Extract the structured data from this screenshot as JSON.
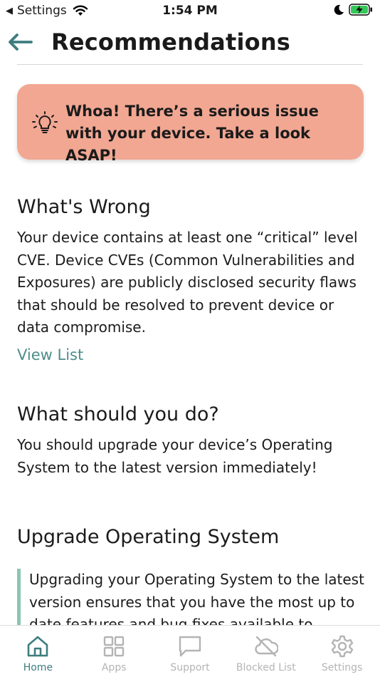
{
  "status_bar": {
    "back_app": "Settings",
    "time": "1:54 PM"
  },
  "header": {
    "title": "Recommendations"
  },
  "alert": {
    "text": "Whoa! There’s a serious issue with your device. Take a look ASAP!",
    "color": "#f2a792"
  },
  "sections": {
    "wrong": {
      "heading": "What's Wrong",
      "body": "Your device contains at least one “critical” level CVE. Device CVEs (Common Vulnerabilities and Exposures) are publicly disclosed security flaws that should be resolved to prevent device or data compromise.",
      "link": "View List"
    },
    "todo": {
      "heading": "What should you do?",
      "body": "You should upgrade your device’s Operating System to the latest version immediately!"
    },
    "upgrade": {
      "heading": "Upgrade Operating System",
      "body": "Upgrading your Operating System to the latest version ensures that you have the most up to date features and bug fixes available to"
    }
  },
  "tabs": [
    {
      "label": "Home",
      "icon": "home-icon",
      "active": true
    },
    {
      "label": "Apps",
      "icon": "apps-grid-icon",
      "active": false
    },
    {
      "label": "Support",
      "icon": "chat-bubble-icon",
      "active": false
    },
    {
      "label": "Blocked List",
      "icon": "cloud-off-icon",
      "active": false
    },
    {
      "label": "Settings",
      "icon": "gear-icon",
      "active": false
    }
  ],
  "colors": {
    "accent": "#3e7d7f",
    "link": "#4e8d8b",
    "quote_bar": "#8cc5b4",
    "inactive_tab": "#b4b4b4"
  }
}
